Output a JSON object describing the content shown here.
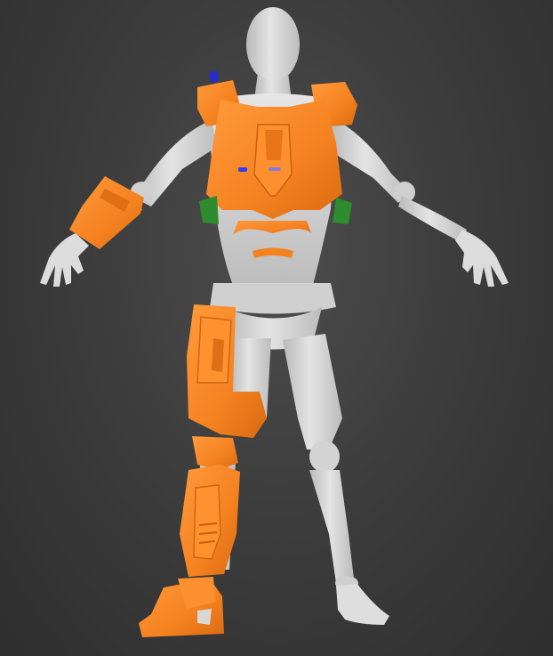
{
  "viewport": {
    "background_color": "#3d3d3d",
    "label": ""
  },
  "model": {
    "mannequin_color": "#d9d9d9",
    "armor_color": "#f58220",
    "accent_green": "#2e8b2e",
    "accent_blue": "#2a2ad0",
    "accent_purple": "#8a7ad8"
  }
}
